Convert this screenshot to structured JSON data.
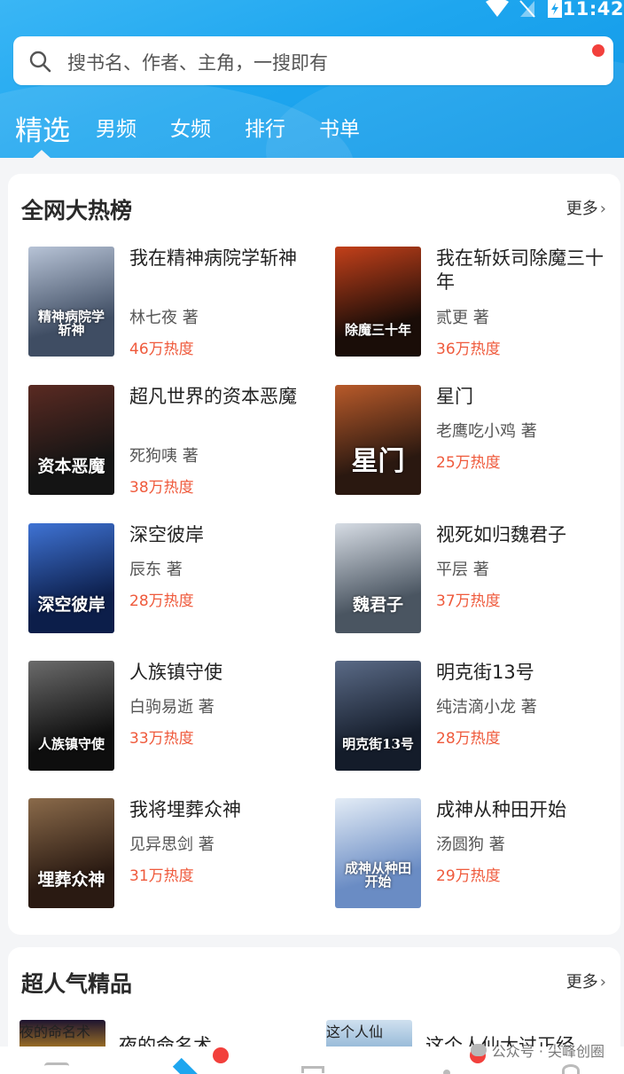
{
  "status_bar": {
    "time": "11:42"
  },
  "search": {
    "placeholder": "搜书名、作者、主角，一搜即有"
  },
  "tabs": [
    {
      "label": "精选",
      "active": true
    },
    {
      "label": "男频"
    },
    {
      "label": "女频"
    },
    {
      "label": "排行"
    },
    {
      "label": "书单"
    }
  ],
  "hot_ranking": {
    "title": "全网大热榜",
    "more_label": "更多",
    "books": [
      {
        "title": "我在精神病院学斩神",
        "author": "林七夜 著",
        "heat": "46万热度",
        "cover_text": "精神病院学斩神",
        "cover_colors": [
          "#3f4d63",
          "#b7c3d6"
        ]
      },
      {
        "title": "我在斩妖司除魔三十年",
        "author": "贰更 著",
        "heat": "36万热度",
        "cover_text": "除魔三十年",
        "cover_colors": [
          "#1a0d08",
          "#c3401a"
        ]
      },
      {
        "title": "超凡世界的资本恶魔",
        "author": "死狗咦 著",
        "heat": "38万热度",
        "cover_text": "资本恶魔",
        "cover_colors": [
          "#141414",
          "#5a2a22"
        ]
      },
      {
        "title": "星门",
        "author": "老鹰吃小鸡 著",
        "heat": "25万热度",
        "cover_text": "星门",
        "cover_colors": [
          "#2a1810",
          "#b85a2a"
        ]
      },
      {
        "title": "深空彼岸",
        "author": "辰东 著",
        "heat": "28万热度",
        "cover_text": "深空彼岸",
        "cover_colors": [
          "#0c1e4a",
          "#3f73d4"
        ]
      },
      {
        "title": "视死如归魏君子",
        "author": "平层 著",
        "heat": "37万热度",
        "cover_text": "魏君子",
        "cover_colors": [
          "#4a5561",
          "#d6dce4"
        ]
      },
      {
        "title": "人族镇守使",
        "author": "白驹易逝 著",
        "heat": "33万热度",
        "cover_text": "人族镇守使",
        "cover_colors": [
          "#0e0e0e",
          "#6b6b6b"
        ]
      },
      {
        "title": "明克街13号",
        "author": "纯洁滴小龙 著",
        "heat": "28万热度",
        "cover_text": "明克街13号",
        "cover_colors": [
          "#141c2a",
          "#5a6a86"
        ]
      },
      {
        "title": "我将埋葬众神",
        "author": "见异思剑 著",
        "heat": "31万热度",
        "cover_text": "埋葬众神",
        "cover_colors": [
          "#2a1a12",
          "#8a6a4a"
        ]
      },
      {
        "title": "成神从种田开始",
        "author": "汤圆狗 著",
        "heat": "29万热度",
        "cover_text": "成神从种田开始",
        "cover_colors": [
          "#6a8cc4",
          "#e3ecf6"
        ]
      }
    ]
  },
  "popular_picks": {
    "title": "超人气精品",
    "more_label": "更多",
    "books": [
      {
        "title": "夜的命名术",
        "cover_text": "夜的命名术",
        "cover_colors": [
          "#1d1430",
          "#e0a020"
        ]
      },
      {
        "title": "这个人仙太过正经",
        "cover_text": "这个人仙",
        "cover_colors": [
          "#cfe0ef",
          "#7aa6cc"
        ]
      }
    ]
  },
  "watermark": {
    "text": "公众号 · 尖峰创圈"
  },
  "colors": {
    "header": "#1ea6ef",
    "heat": "#ef5a3c",
    "badge": "#f2403c"
  }
}
